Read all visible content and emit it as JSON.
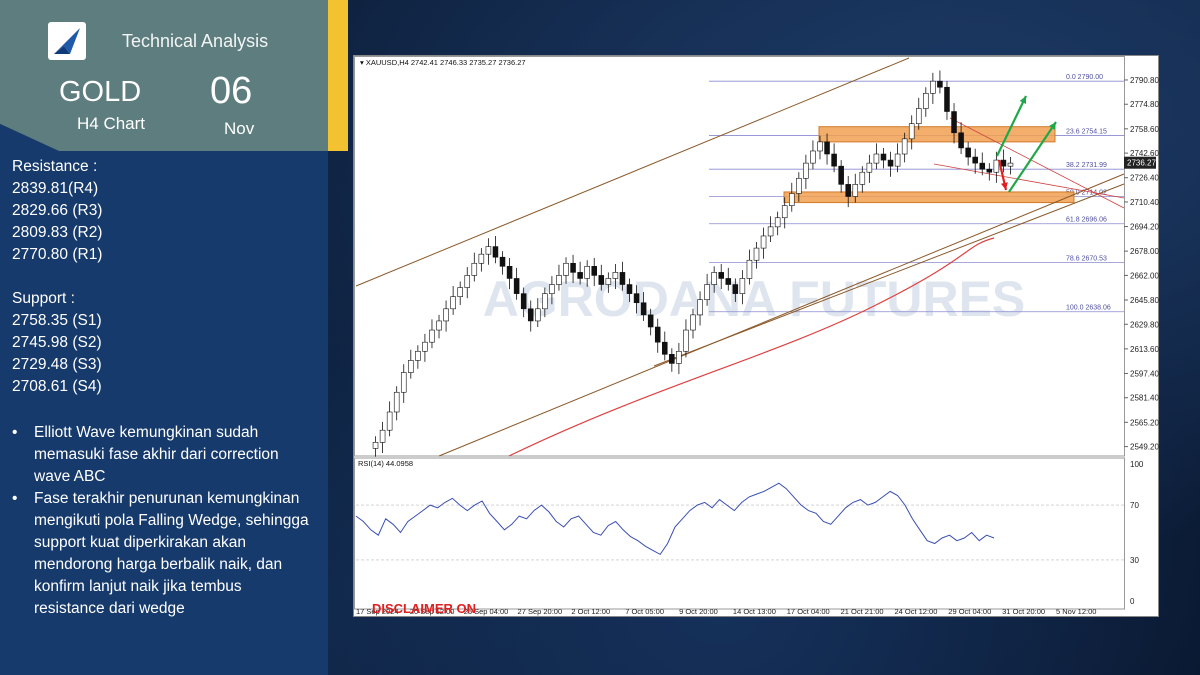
{
  "header": {
    "section_title": "Technical Analysis",
    "instrument": "GOLD",
    "timeframe": "H4 Chart",
    "day": "06",
    "month": "Nov"
  },
  "resistance": {
    "heading": "Resistance :",
    "levels": [
      "2839.81(R4)",
      "2829.66 (R3)",
      "2809.83 (R2)",
      "2770.80 (R1)"
    ]
  },
  "support": {
    "heading": "Support :",
    "levels": [
      "2758.35 (S1)",
      "2745.98 (S2)",
      "2729.48 (S3)",
      "2708.61 (S4)"
    ]
  },
  "notes": [
    "Elliott Wave kemungkinan sudah memasuki fase akhir dari correction wave ABC",
    "Fase terakhir penurunan kemungkinan mengikuti pola Falling Wedge, sehingga support kuat diperkirakan akan mendorong harga berbalik naik, dan konfirm lanjut naik jika tembus resistance dari wedge"
  ],
  "colors": {
    "sidebar": "#163a6b",
    "header_box": "#5d7d7f",
    "accent_yellow": "#f2c230",
    "zone_orange": "#f0a050",
    "rsi_line": "#3a4fb0",
    "ma_line": "#e04040",
    "channel_line": "#8b5a2b",
    "arrow_green": "#1ea84a",
    "arrow_red": "#e02020"
  },
  "chart_data": {
    "type": "candlestick",
    "symbol_info": "XAUUSD,H4  2742.41 2746.33 2735.27 2736.27",
    "current_price": "2736.27",
    "watermark": "AGRODANA FUTURES",
    "disclaimer": "DISCLAIMER ON",
    "price_axis": [
      "2790.80",
      "2774.80",
      "2758.60",
      "2742.60",
      "2726.40",
      "2710.40",
      "2694.20",
      "2678.00",
      "2662.00",
      "2645.80",
      "2629.80",
      "2613.60",
      "2597.40",
      "2581.40",
      "2565.20",
      "2549.20"
    ],
    "ylim": [
      2543,
      2800
    ],
    "time_axis": [
      "17 Sep 2024",
      "20 Sep 12:00",
      "25 Sep 04:00",
      "27 Sep 20:00",
      "2 Oct 12:00",
      "7 Oct 05:00",
      "9 Oct 20:00",
      "14 Oct 13:00",
      "17 Oct 04:00",
      "21 Oct 21:00",
      "24 Oct 12:00",
      "29 Oct 04:00",
      "31 Oct 20:00",
      "5 Nov 12:00"
    ],
    "fibonacci": [
      {
        "label": "0.0",
        "price": "2790.00"
      },
      {
        "label": "23.6",
        "price": "2754.15"
      },
      {
        "label": "38.2",
        "price": "2731.99"
      },
      {
        "label": "50.0",
        "price": "2714.02"
      },
      {
        "label": "61.8",
        "price": "2696.06"
      },
      {
        "label": "78.6",
        "price": "2670.53"
      },
      {
        "label": "100.0",
        "price": "2638.06"
      }
    ],
    "close": [
      2552,
      2560,
      2572,
      2585,
      2598,
      2606,
      2612,
      2618,
      2626,
      2632,
      2640,
      2648,
      2654,
      2662,
      2670,
      2676,
      2681,
      2674,
      2668,
      2660,
      2650,
      2640,
      2632,
      2640,
      2650,
      2656,
      2662,
      2670,
      2664,
      2660,
      2668,
      2662,
      2656,
      2660,
      2664,
      2656,
      2650,
      2644,
      2636,
      2628,
      2618,
      2610,
      2604,
      2612,
      2626,
      2636,
      2646,
      2656,
      2664,
      2660,
      2656,
      2650,
      2660,
      2672,
      2680,
      2688,
      2694,
      2700,
      2708,
      2716,
      2726,
      2736,
      2744,
      2750,
      2742,
      2734,
      2722,
      2714,
      2722,
      2730,
      2736,
      2742,
      2738,
      2734,
      2742,
      2752,
      2762,
      2772,
      2782,
      2790,
      2786,
      2770,
      2756,
      2746,
      2740,
      2736,
      2732,
      2730,
      2738,
      2734,
      2736
    ],
    "rsi": {
      "label": "RSI(14) 44.0958",
      "levels": [
        "100",
        "70",
        "30",
        "0"
      ],
      "values": [
        62,
        58,
        52,
        48,
        60,
        56,
        50,
        58,
        62,
        66,
        70,
        68,
        72,
        75,
        70,
        66,
        70,
        73,
        64,
        58,
        52,
        56,
        62,
        60,
        66,
        70,
        65,
        58,
        54,
        60,
        62,
        56,
        50,
        48,
        55,
        58,
        52,
        47,
        44,
        40,
        37,
        34,
        42,
        54,
        60,
        66,
        70,
        72,
        68,
        74,
        70,
        66,
        72,
        76,
        78,
        80,
        83,
        86,
        82,
        76,
        70,
        66,
        64,
        58,
        56,
        62,
        68,
        72,
        74,
        70,
        72,
        76,
        80,
        77,
        70,
        60,
        52,
        44,
        42,
        46,
        48,
        44,
        46,
        50,
        44,
        48,
        46
      ]
    }
  }
}
